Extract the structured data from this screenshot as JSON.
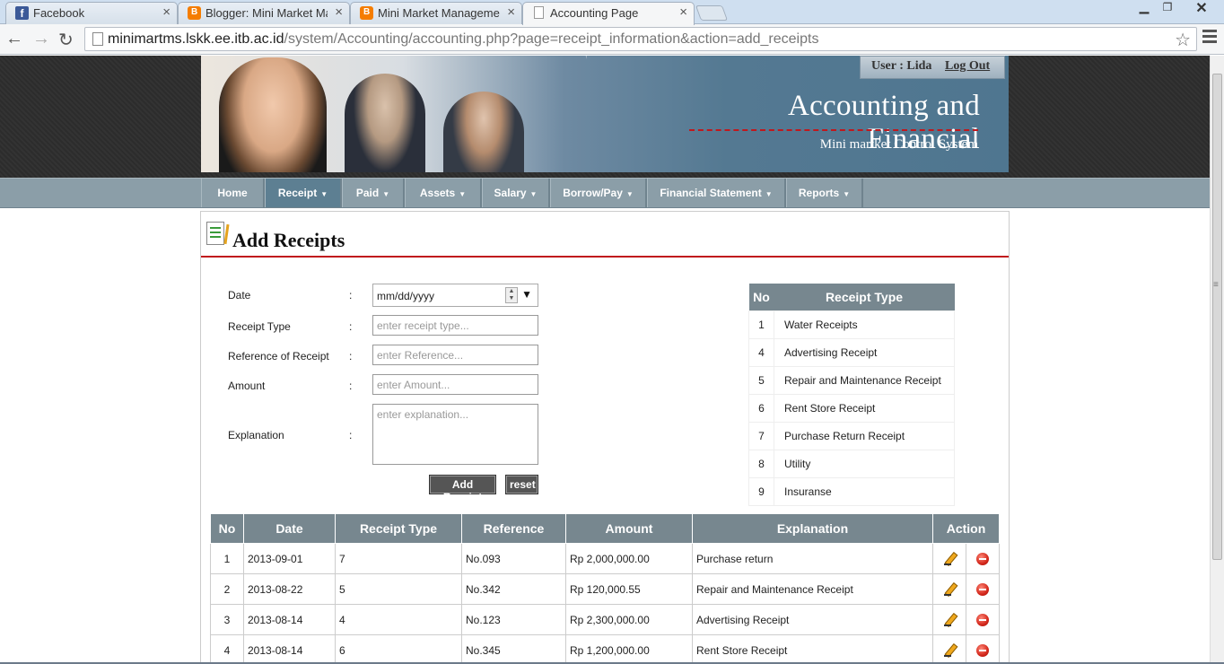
{
  "browser": {
    "tabs": [
      {
        "label": "Facebook",
        "icon": "facebook-icon"
      },
      {
        "label": "Blogger: Mini Market Man",
        "icon": "blogger-icon"
      },
      {
        "label": "Mini Market Management",
        "icon": "blogger-icon"
      },
      {
        "label": "Accounting Page",
        "icon": "page-icon"
      }
    ],
    "url_host": "minimartms.lskk.ee.itb.ac.id",
    "url_path": "/system/Accounting/accounting.php?page=receipt_information&action=add_receipts"
  },
  "header": {
    "user_label": "User : Lida",
    "logout_label": "Log Out",
    "title": "Accounting and Financial",
    "subtitle": "Mini martket Control System"
  },
  "nav": [
    {
      "label": "Home",
      "caret": false
    },
    {
      "label": "Receipt",
      "caret": true
    },
    {
      "label": "Paid",
      "caret": true
    },
    {
      "label": "Assets",
      "caret": true
    },
    {
      "label": "Salary",
      "caret": true
    },
    {
      "label": "Borrow/Pay",
      "caret": true
    },
    {
      "label": "Financial Statement",
      "caret": true
    },
    {
      "label": "Reports",
      "caret": true
    }
  ],
  "page": {
    "title": "Add Receipts"
  },
  "form": {
    "colon": ":",
    "date_label": "Date",
    "date_value": "mm/dd/yyyy",
    "type_label": "Receipt Type",
    "type_placeholder": "enter receipt type...",
    "reference_label": "Reference of Receipt",
    "reference_placeholder": "enter Reference...",
    "amount_label": "Amount",
    "amount_placeholder": "enter Amount...",
    "explanation_label": "Explanation",
    "explanation_placeholder": "enter explanation...",
    "submit_label": "Add Receipt",
    "reset_label": "reset"
  },
  "receipt_types": {
    "headers": [
      "No",
      "Receipt Type"
    ],
    "rows": [
      {
        "no": "1",
        "name": "Water Receipts"
      },
      {
        "no": "4",
        "name": "Advertising Receipt"
      },
      {
        "no": "5",
        "name": "Repair and Maintenance Receipt"
      },
      {
        "no": "6",
        "name": "Rent Store Receipt"
      },
      {
        "no": "7",
        "name": "Purchase Return Receipt"
      },
      {
        "no": "8",
        "name": "Utility"
      },
      {
        "no": "9",
        "name": "Insuranse"
      }
    ]
  },
  "receipts": {
    "headers": [
      "No",
      "Date",
      "Receipt Type",
      "Reference",
      "Amount",
      "Explanation",
      "Action"
    ],
    "rows": [
      {
        "no": "1",
        "date": "2013-09-01",
        "type": "7",
        "reference": "No.093",
        "amount": "Rp 2,000,000.00",
        "explanation": "Purchase return"
      },
      {
        "no": "2",
        "date": "2013-08-22",
        "type": "5",
        "reference": "No.342",
        "amount": "Rp 120,000.55",
        "explanation": "Repair and Maintenance Receipt"
      },
      {
        "no": "3",
        "date": "2013-08-14",
        "type": "4",
        "reference": "No.123",
        "amount": "Rp 2,300,000.00",
        "explanation": "Advertising Receipt"
      },
      {
        "no": "4",
        "date": "2013-08-14",
        "type": "6",
        "reference": "No.345",
        "amount": "Rp 1,200,000.00",
        "explanation": "Rent Store Receipt"
      }
    ]
  }
}
